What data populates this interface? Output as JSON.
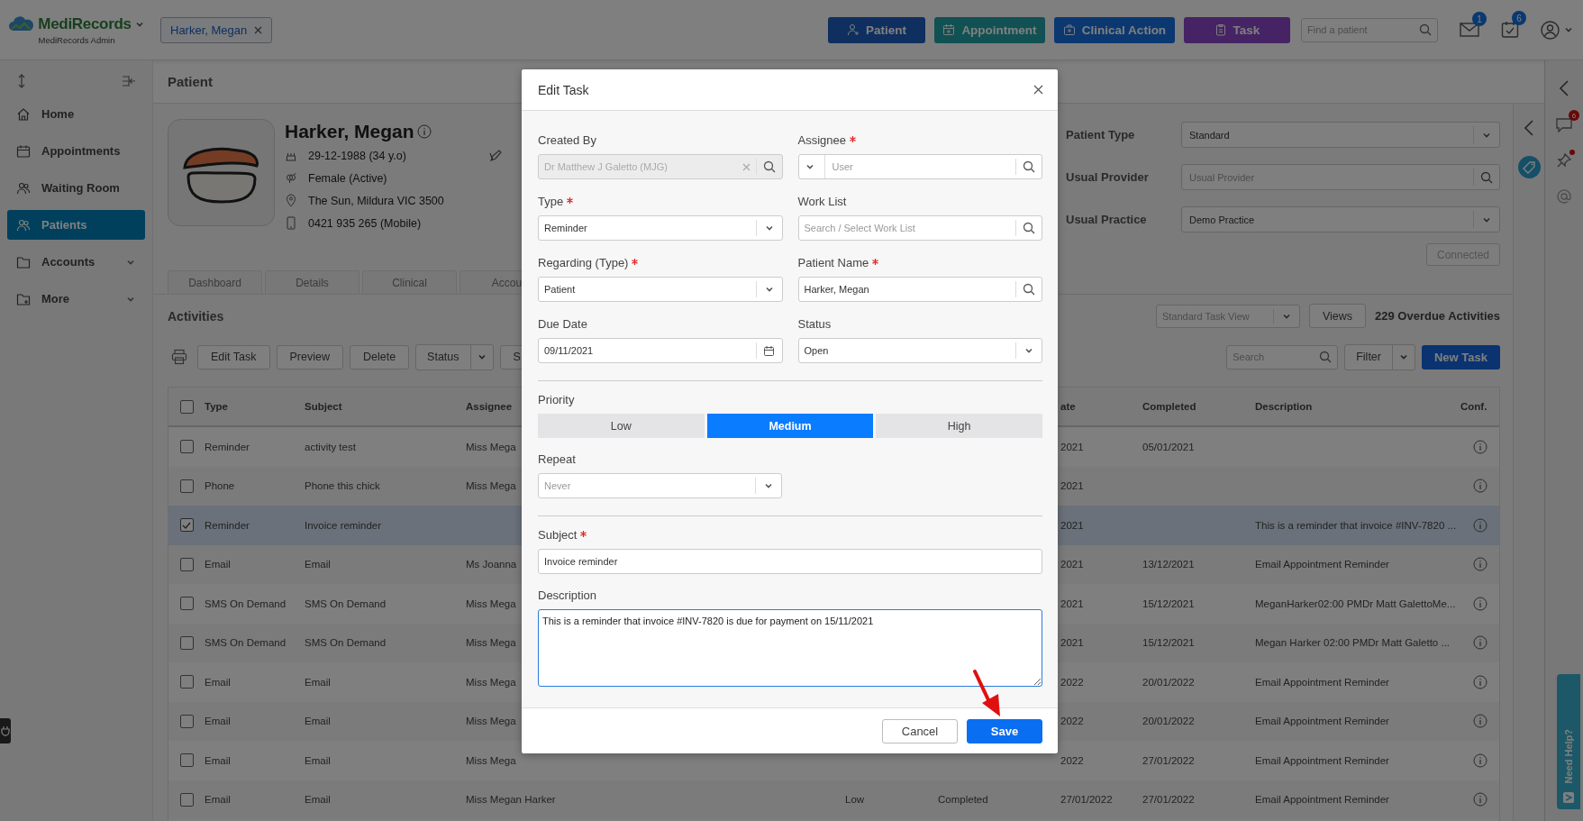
{
  "header": {
    "logo": "MediRecords",
    "subtitle": "MediRecords Admin",
    "open_tab": "Harker, Megan",
    "actions": [
      {
        "label": "Patient"
      },
      {
        "label": "Appointment"
      },
      {
        "label": "Clinical Action"
      },
      {
        "label": "Task"
      }
    ],
    "search": {
      "placeholder": "Find a patient"
    },
    "mail_badge": "1",
    "tasks_badge": "6"
  },
  "sidebar": {
    "items": [
      {
        "label": "Home",
        "selected": false,
        "expandable": false
      },
      {
        "label": "Appointments",
        "selected": false,
        "expandable": false
      },
      {
        "label": "Waiting Room",
        "selected": false,
        "expandable": false
      },
      {
        "label": "Patients",
        "selected": true,
        "expandable": false
      },
      {
        "label": "Accounts",
        "selected": false,
        "expandable": true
      },
      {
        "label": "More",
        "selected": false,
        "expandable": true
      }
    ]
  },
  "page_title": "Patient",
  "patient": {
    "name": "Harker, Megan",
    "dob": "29-12-1988 (34 y.o)",
    "gender": "Female (Active)",
    "address": "The Sun, Mildura VIC 3500",
    "phone": "0421 935 265 (Mobile)"
  },
  "patient_tabs": [
    "Dashboard",
    "Details",
    "Clinical",
    "Accou"
  ],
  "patient_form": [
    {
      "label": "Patient Type",
      "kind": "select",
      "value": "Standard"
    },
    {
      "label": "Usual Provider",
      "kind": "search",
      "placeholder": "Usual Provider"
    },
    {
      "label": "Usual Practice",
      "kind": "select",
      "value": "Demo Practice"
    }
  ],
  "connect_button": "Connected",
  "activities": {
    "title": "Activities",
    "view": "Standard Task View",
    "views_button": "Views",
    "overdue": "229 Overdue Activities",
    "toolbar": [
      {
        "label": "Edit Task",
        "kind": "button"
      },
      {
        "label": "Preview",
        "kind": "button"
      },
      {
        "label": "Delete",
        "kind": "button"
      },
      {
        "label": "Status",
        "kind": "split"
      },
      {
        "label": "S",
        "kind": "button"
      }
    ],
    "search": {
      "placeholder": "Search"
    },
    "filter": "Filter",
    "new_task": "New Task"
  },
  "table": {
    "all_checked": false,
    "columns": [
      "Type",
      "Subject",
      "Assignee",
      "ate",
      "Completed",
      "Description",
      "Conf."
    ],
    "rows": [
      {
        "checked": false,
        "type": "Reminder",
        "subject": "activity test",
        "assignee": "Miss Mega",
        "due": "2021",
        "completed": "05/01/2021"
      },
      {
        "checked": false,
        "type": "Phone",
        "subject": "Phone this chick",
        "assignee": "Miss Mega",
        "due": "2021"
      },
      {
        "checked": true,
        "type": "Reminder",
        "subject": "Invoice reminder",
        "due": "2021",
        "description": "This is a reminder that invoice #INV-7820 ..."
      },
      {
        "checked": false,
        "type": "Email",
        "subject": "Email",
        "assignee": "Ms Joanna",
        "due": "2021",
        "completed": "13/12/2021",
        "description": "Email Appointment Reminder"
      },
      {
        "checked": false,
        "type": "SMS On Demand",
        "subject": "SMS On Demand",
        "assignee": "Miss Mega",
        "due": "2021",
        "completed": "15/12/2021",
        "description": "MeganHarker02:00 PMDr Matt GalettoMe..."
      },
      {
        "checked": false,
        "type": "SMS On Demand",
        "subject": "SMS On Demand",
        "assignee": "Miss Mega",
        "due": "2021",
        "completed": "15/12/2021",
        "description": "Megan Harker 02:00 PMDr Matt Galetto ..."
      },
      {
        "checked": false,
        "type": "Email",
        "subject": "Email",
        "assignee": "Miss Mega",
        "due": "2022",
        "completed": "20/01/2022",
        "description": "Email Appointment Reminder"
      },
      {
        "checked": false,
        "type": "Email",
        "subject": "Email",
        "assignee": "Miss Mega",
        "due": "2022",
        "completed": "20/01/2022",
        "description": "Email Appointment Reminder"
      },
      {
        "checked": false,
        "type": "Email",
        "subject": "Email",
        "assignee": "Miss Mega",
        "due": "2022",
        "completed": "27/01/2022",
        "description": "Email Appointment Reminder"
      },
      {
        "checked": false,
        "type": "Email",
        "subject": "Email",
        "assignee": "Miss Megan Harker",
        "priority": "Low",
        "status": "Completed",
        "due": "27/01/2022",
        "completed": "27/01/2022",
        "description": "Email Appointment Reminder"
      }
    ]
  },
  "right_rail": {
    "chat_badge": "6"
  },
  "help_tab": "Need Help?",
  "modal": {
    "title": "Edit Task",
    "fields": [
      {
        "label": "Created By",
        "kind": "clearable",
        "value": "Dr Matthew J Galetto (MJG)",
        "required": false,
        "disabled": true
      },
      {
        "label": "Assignee",
        "kind": "lookup",
        "placeholder": "User",
        "required": true,
        "disabled": false
      },
      {
        "label": "Type",
        "kind": "select",
        "value": "Reminder",
        "required": true,
        "disabled": false
      },
      {
        "label": "Work List",
        "kind": "search",
        "placeholder": "Search / Select Work List",
        "required": false,
        "disabled": false
      },
      {
        "label": "Regarding (Type)",
        "kind": "select",
        "value": "Patient",
        "required": true,
        "disabled": false
      },
      {
        "label": "Patient Name",
        "kind": "search",
        "value": "Harker, Megan",
        "required": true,
        "disabled": false
      },
      {
        "label": "Due Date",
        "kind": "date",
        "value": "09/11/2021",
        "required": false,
        "disabled": false
      },
      {
        "label": "Status",
        "kind": "select",
        "value": "Open",
        "required": false,
        "disabled": false
      }
    ],
    "priority": {
      "label": "Priority",
      "options": [
        {
          "label": "Low",
          "selected": false
        },
        {
          "label": "Medium",
          "selected": true
        },
        {
          "label": "High",
          "selected": false
        }
      ]
    },
    "repeat": {
      "label": "Repeat",
      "kind": "select",
      "placeholder": "Never",
      "required": false,
      "disabled": false
    },
    "subject": {
      "label": "Subject",
      "value": "Invoice reminder",
      "required": true,
      "disabled": false
    },
    "description": {
      "label": "Description",
      "value": "This is a reminder that invoice #INV-7820 is due for payment on 15/11/2021"
    },
    "buttons": [
      {
        "label": "Cancel",
        "kind": "secondary"
      },
      {
        "label": "Save",
        "kind": "primary"
      }
    ]
  }
}
